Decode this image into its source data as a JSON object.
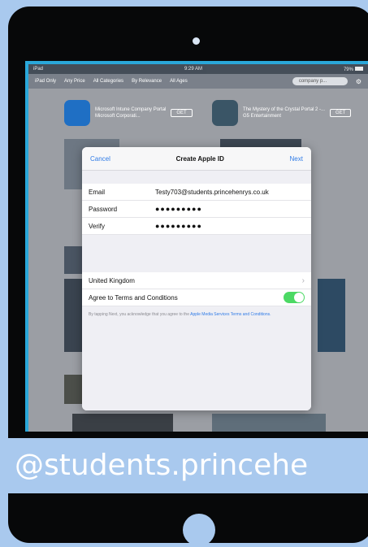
{
  "status_bar": {
    "carrier": "iPad",
    "time": "9:29 AM",
    "battery": "79%"
  },
  "filters": {
    "items": [
      "iPad Only",
      "Any Price",
      "All Categories",
      "By Relevance",
      "All Ages"
    ],
    "search_value": "company p..."
  },
  "background_apps": [
    {
      "name": "Microsoft Intune Company Portal",
      "developer": "Microsoft Corporati...",
      "button": "GET"
    },
    {
      "name": "The Mystery of the Crystal Portal 2 -...",
      "developer": "G5 Entertainment",
      "button": "GET"
    }
  ],
  "modal": {
    "cancel": "Cancel",
    "title": "Create Apple ID",
    "next": "Next",
    "email_label": "Email",
    "email_value": "Testy703@students.princehenrys.co.uk",
    "password_label": "Password",
    "password_value": "●●●●●●●●●",
    "verify_label": "Verify",
    "verify_value": "●●●●●●●●●",
    "country": "United Kingdom",
    "terms_label": "Agree to Terms and Conditions",
    "terms_on": true,
    "footer_text": "By tapping Next, you acknowledge that you agree to the",
    "footer_link": "Apple Media Services Terms and Conditions."
  },
  "banner_text": "@students.princehe",
  "colors": {
    "accent": "#2f7be6",
    "toggle_on": "#4cd964",
    "frame": "#070809",
    "background": "#a9c9ee"
  }
}
